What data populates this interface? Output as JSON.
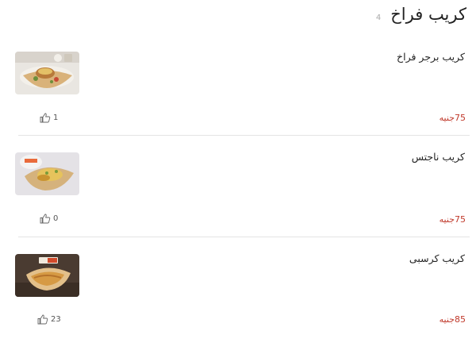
{
  "category": {
    "title": "كريب فراخ",
    "count": "4"
  },
  "items": [
    {
      "name": "كريب برجر فراخ",
      "price": "75جنيه",
      "likes": "1",
      "image": "chicken-burger-crepe-photo"
    },
    {
      "name": "كريب ناجتس",
      "price": "75جنيه",
      "likes": "0",
      "image": "nuggets-crepe-photo"
    },
    {
      "name": "كريب كرسبى",
      "price": "85جنيه",
      "likes": "23",
      "image": "crispy-crepe-photo"
    }
  ],
  "icons": {
    "like": "thumbs-up-icon"
  },
  "colors": {
    "price": "#c0392b",
    "divider": "#e4e4e4",
    "title": "#222222"
  }
}
